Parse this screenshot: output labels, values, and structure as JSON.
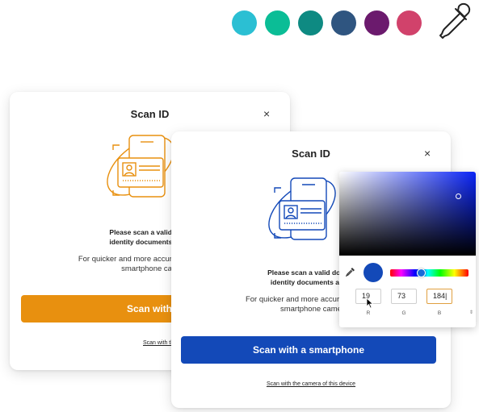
{
  "swatches": [
    {
      "name": "swatch-teal-light",
      "color": "#2bbfd3"
    },
    {
      "name": "swatch-teal-green",
      "color": "#0bbd96"
    },
    {
      "name": "swatch-teal-dark",
      "color": "#0e8a82"
    },
    {
      "name": "swatch-navy",
      "color": "#2f5580"
    },
    {
      "name": "swatch-purple",
      "color": "#6b1a6d"
    },
    {
      "name": "swatch-pink",
      "color": "#d1426b"
    }
  ],
  "back_card": {
    "title": "Scan ID",
    "close": "×",
    "message_line1": "Please scan a valid docu",
    "message_line2": "identity documents are a",
    "info_line1": "For quicker and more accurate",
    "info_line2": "smartphone cam",
    "button_label": "Scan with a smar",
    "button_color": "#e8900f",
    "accent_color": "#e8900f",
    "link_label": "Scan with the camera of t"
  },
  "front_card": {
    "title": "Scan ID",
    "close": "×",
    "message_line1": "Please scan a valid docum",
    "message_line2": "identity documents are a",
    "info_line1": "For quicker and more accurate so",
    "info_line2": "smartphone came",
    "button_label": "Scan with a smartphone",
    "button_color": "#1349b8",
    "accent_color": "#1349b8",
    "link_label": "Scan with the camera of this device"
  },
  "color_picker": {
    "r": "19",
    "g": "73",
    "b": "184|",
    "r_label": "R",
    "g_label": "G",
    "b_label": "B",
    "mode_toggle": "⇕",
    "preview_color": "#1349b8"
  }
}
